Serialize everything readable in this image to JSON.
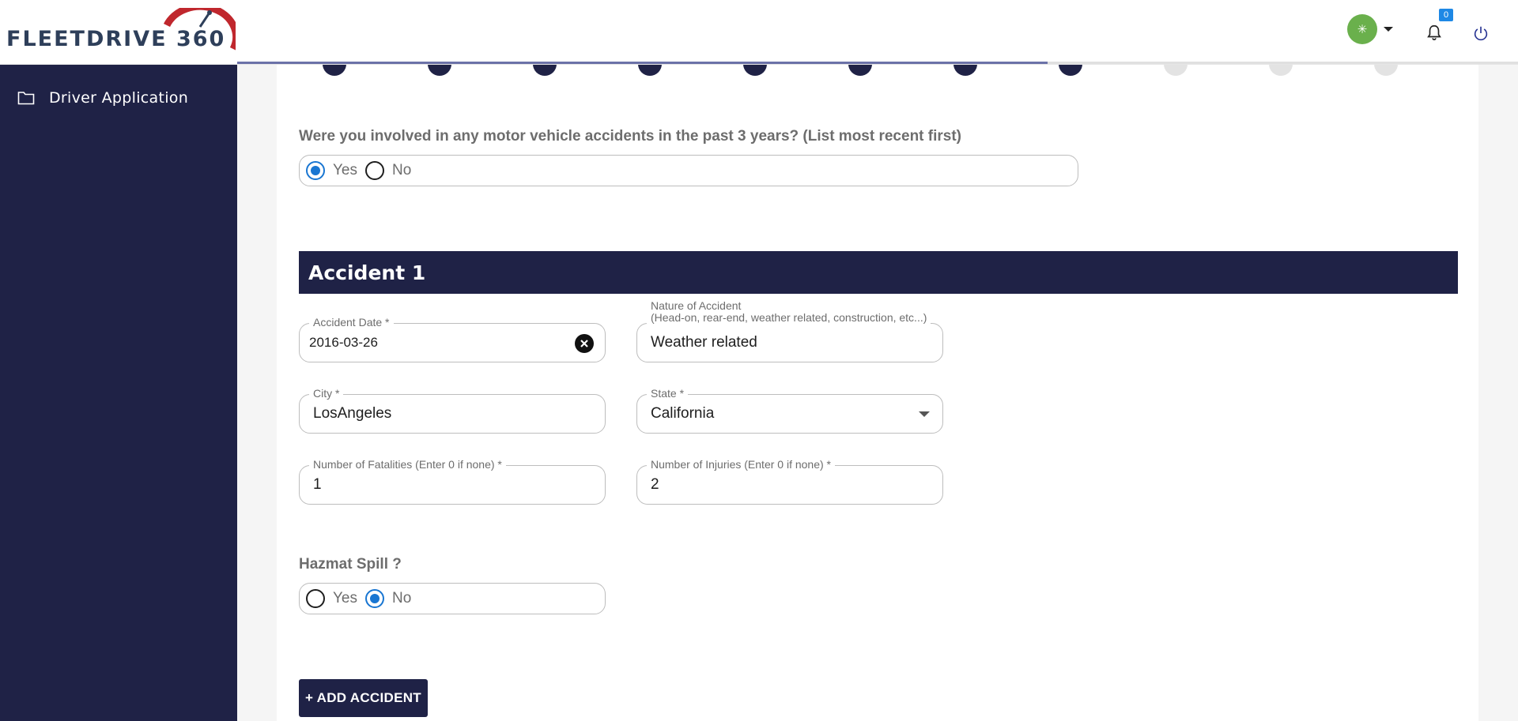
{
  "brand": {
    "name": "FLEETDRIVE 360"
  },
  "header": {
    "avatar_initial": "✳",
    "notifications_count": "0"
  },
  "sidebar": {
    "items": [
      {
        "label": "Driver Application",
        "icon": "folder-icon"
      }
    ]
  },
  "stepper": {
    "completed_steps": 8,
    "total_steps": 11,
    "progress_fraction": 0.667
  },
  "form": {
    "accidents_question": "Were you involved in any motor vehicle accidents in the past 3 years? (List most recent first)",
    "accidents_options": {
      "yes": "Yes",
      "no": "No",
      "selected": "yes"
    },
    "section_title": "Accident 1",
    "accident_date": {
      "label": "Accident Date *",
      "value": "2016-03-26"
    },
    "nature": {
      "label_line1": "Nature of Accident",
      "label_line2": "(Head-on, rear-end, weather related, construction, etc...)",
      "value": "Weather related"
    },
    "city": {
      "label": "City *",
      "value": "LosAngeles"
    },
    "state": {
      "label": "State *",
      "value": "California"
    },
    "fatalities": {
      "label": "Number of Fatalities (Enter 0 if none) *",
      "value": "1"
    },
    "injuries": {
      "label": "Number of Injuries (Enter 0 if none) *",
      "value": "2"
    },
    "hazmat_question": "Hazmat Spill ?",
    "hazmat_options": {
      "yes": "Yes",
      "no": "No",
      "selected": "no"
    },
    "add_button": "+ ADD ACCIDENT"
  },
  "colors": {
    "navy": "#1f2246",
    "radio_selected": "#1976d2",
    "avatar_green": "#6ab04c",
    "badge_blue": "#1e88e5",
    "logo_red": "#c0272d",
    "logo_text": "#2e3f5a"
  }
}
